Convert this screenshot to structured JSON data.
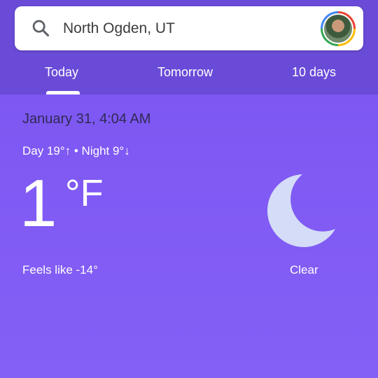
{
  "search": {
    "location": "North Ogden, UT",
    "icon": "search-icon"
  },
  "tabs": [
    {
      "label": "Today",
      "selected": true
    },
    {
      "label": "Tomorrow",
      "selected": false
    },
    {
      "label": "10 days",
      "selected": false
    }
  ],
  "weather": {
    "datetime": "January 31, 4:04 AM",
    "day_night": "Day 19°↑ • Night 9°↓",
    "temperature": "1",
    "unit": "°F",
    "feels_like": "Feels like -14°",
    "condition": "Clear",
    "condition_icon": "moon-icon"
  },
  "colors": {
    "header_bg": "#6a4bd8",
    "main_bg": "#7e57f2",
    "moon": "#d4dcf8",
    "date_text": "#2e2a55"
  }
}
